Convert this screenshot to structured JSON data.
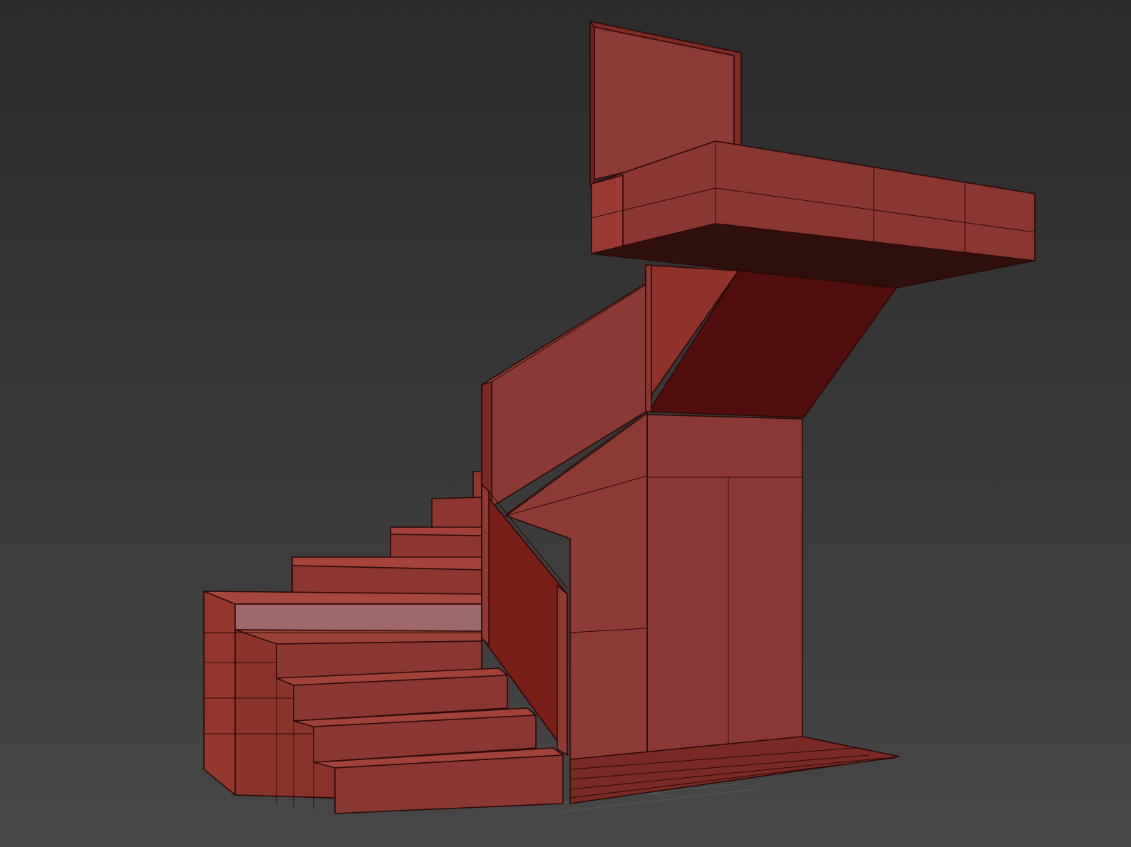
{
  "scene": {
    "background_top": "#2b2b2b",
    "background_bottom": "#474747",
    "material_color": "#8a3a33",
    "highlight_color": "#9e6a6c",
    "shadow_color": "#4e0d0d"
  }
}
